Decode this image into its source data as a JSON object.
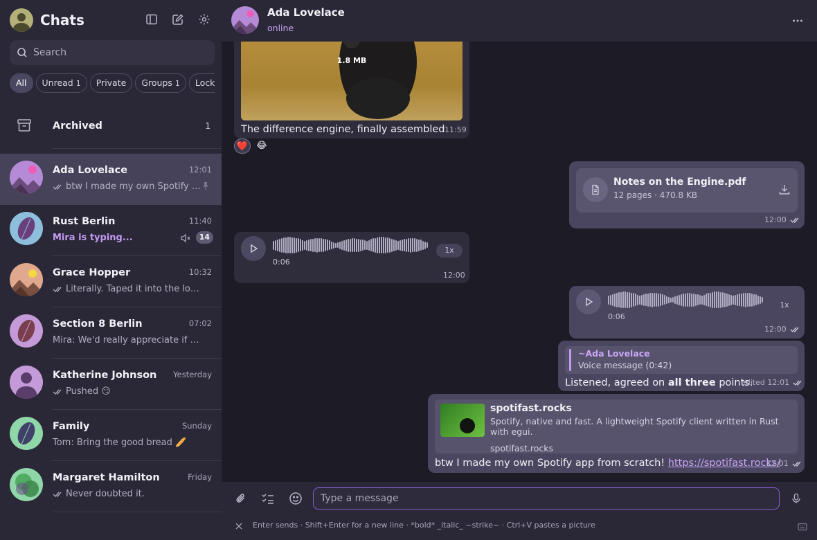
{
  "sidebar": {
    "title": "Chats",
    "search_placeholder": "Search",
    "filters": [
      {
        "label": "All",
        "count": ""
      },
      {
        "label": "Unread",
        "count": "1"
      },
      {
        "label": "Private",
        "count": ""
      },
      {
        "label": "Groups",
        "count": "1"
      },
      {
        "label": "Locke",
        "count": ""
      }
    ],
    "archived": {
      "label": "Archived",
      "count": "1"
    },
    "chats": [
      {
        "name": "Ada Lovelace",
        "time": "12:01",
        "preview": "btw I made my own Spotify a...",
        "read": true,
        "pinned": true,
        "avatar": "mountain-pink"
      },
      {
        "name": "Rust Berlin",
        "time": "11:40",
        "preview": "Mira is typing...",
        "typing": true,
        "muted": true,
        "unread": "14",
        "avatar": "leaf-purple"
      },
      {
        "name": "Grace Hopper",
        "time": "10:32",
        "preview": "Literally. Taped it into the logbo...",
        "read": true,
        "avatar": "mountain-peach"
      },
      {
        "name": "Section 8 Berlin",
        "time": "07:02",
        "preview": "Mira: We'd really appreciate if you ...",
        "avatar": "leaf-brown"
      },
      {
        "name": "Katherine Johnson",
        "time": "Yesterday",
        "preview": "Pushed 😏",
        "read": true,
        "avatar": "person-purple"
      },
      {
        "name": "Family",
        "time": "Sunday",
        "preview": "Tom: Bring the good bread 🥖",
        "avatar": "leaf-green"
      },
      {
        "name": "Margaret Hamilton",
        "time": "Friday",
        "preview": "Never doubted it.",
        "read": true,
        "avatar": "circles-green"
      }
    ]
  },
  "header": {
    "title": "Ada Lovelace",
    "status": "online"
  },
  "messages": {
    "photo": {
      "size": "1.8 MB",
      "caption": "The difference engine, finally assembled",
      "time": "11:59",
      "reactions": [
        "❤️",
        "😂"
      ]
    },
    "file": {
      "name": "Notes on the Engine.pdf",
      "meta": "12 pages · 470.8 KB",
      "time": "12:00"
    },
    "voice_in": {
      "duration": "0:06",
      "speed": "1x",
      "time": "12:00"
    },
    "voice_out": {
      "duration": "0:06",
      "speed": "1x",
      "time": "12:00"
    },
    "reply": {
      "quote_name": "~Ada Lovelace",
      "quote_text": "Voice message (0:42)",
      "text_before": "Listened, agreed on ",
      "text_bold": "all three",
      "text_after": " points.",
      "meta": "edited 12:01"
    },
    "link": {
      "title": "spotifast.rocks",
      "description": "Spotify, native and fast. A lightweight Spotify client written in Rust with egui.",
      "host": "spotifast.rocks",
      "text": "btw I made my own Spotify app from scratch!",
      "url": "https://spotifast.rocks/",
      "time": "12:01"
    }
  },
  "composer": {
    "placeholder": "Type a message",
    "hint": "Enter sends · Shift+Enter for a new line · *bold* _italic_ ~strike~ · Ctrl+V pastes a picture"
  },
  "colors": {
    "accent": "#c29bf0",
    "sidebar_bg": "#2a2837",
    "chat_bg": "#1c1b26",
    "outgoing_bubble": "#4a4660",
    "incoming_bubble": "#2f2c3c"
  }
}
